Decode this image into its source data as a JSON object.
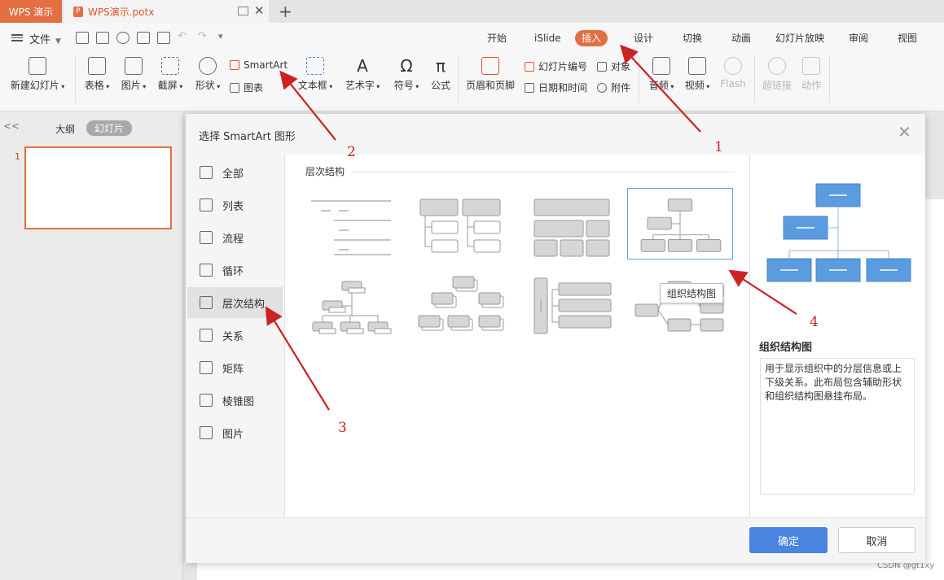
{
  "titlebar": {
    "app_label": "WPS 演示",
    "doc_tab_label": "WPS演示.potx",
    "new_tab": "+"
  },
  "menu": {
    "file_label": "文件",
    "tabs": [
      {
        "label": "开始",
        "active": false
      },
      {
        "label": "iSlide",
        "active": false
      },
      {
        "label": "插入",
        "active": true
      },
      {
        "label": "设计",
        "active": false
      },
      {
        "label": "切换",
        "active": false
      },
      {
        "label": "动画",
        "active": false
      },
      {
        "label": "幻灯片放映",
        "active": false
      },
      {
        "label": "审阅",
        "active": false
      },
      {
        "label": "视图",
        "active": false
      }
    ]
  },
  "ribbon": {
    "new_slide": "新建幻灯片",
    "table": "表格",
    "picture": "图片",
    "screenshot": "截屏",
    "shape": "形状",
    "smartart": "SmartArt",
    "chart": "图表",
    "textbox": "文本框",
    "wordart": "艺术字",
    "symbol": "符号",
    "formula": "公式",
    "header_footer": "页眉和页脚",
    "slide_number": "幻灯片编号",
    "object": "对象",
    "date_time": "日期和时间",
    "attachment": "附件",
    "audio": "音频",
    "video": "视频",
    "flash": "Flash",
    "hyperlink": "超链接",
    "action": "动作"
  },
  "left_pane": {
    "collapse": "<<",
    "outline_tab": "大纲",
    "slides_tab": "幻灯片",
    "slide_number": "1"
  },
  "dialog": {
    "title": "选择 SmartArt 图形",
    "categories": [
      {
        "label": "全部",
        "icon": "all-icon"
      },
      {
        "label": "列表",
        "icon": "list-icon"
      },
      {
        "label": "流程",
        "icon": "process-icon"
      },
      {
        "label": "循环",
        "icon": "cycle-icon"
      },
      {
        "label": "层次结构",
        "icon": "hierarchy-icon",
        "selected": true
      },
      {
        "label": "关系",
        "icon": "relationship-icon"
      },
      {
        "label": "矩阵",
        "icon": "matrix-icon"
      },
      {
        "label": "棱锥图",
        "icon": "pyramid-icon"
      },
      {
        "label": "图片",
        "icon": "picture-icon"
      }
    ],
    "section_title": "层次结构",
    "tooltip": "组织结构图",
    "preview_name": "组织结构图",
    "description": "用于显示组织中的分层信息或上下级关系。此布局包含辅助形状和组织结构图悬挂布局。",
    "ok_label": "确定",
    "cancel_label": "取消"
  },
  "annotations": [
    "1",
    "2",
    "3",
    "4"
  ],
  "watermark": "CSDN @gt1xy",
  "colors": {
    "accent": "#e36f43",
    "primary_button": "#4a84e0",
    "preview_box": "#5b9be0",
    "arrow": "#cc2222"
  }
}
